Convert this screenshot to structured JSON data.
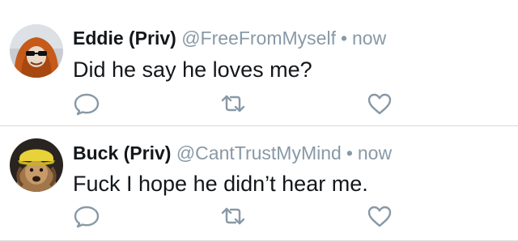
{
  "tweets": [
    {
      "display_name": "Eddie (Priv)",
      "handle": "@FreeFromMyself",
      "separator": "•",
      "timestamp": "now",
      "text": "Did he say he loves me?",
      "avatar_icon": "orange-hoodie-sunglasses-avatar"
    },
    {
      "display_name": "Buck (Priv)",
      "handle": "@CantTrustMyMind",
      "separator": "•",
      "timestamp": "now",
      "text": "Fuck I hope he didn’t hear me.",
      "avatar_icon": "dog-with-yellow-cap-avatar"
    }
  ],
  "colors": {
    "name": "#14171a",
    "meta": "#8899a6",
    "icon": "#8899a6",
    "divider": "#d6d8da"
  },
  "actions": {
    "reply_icon": "reply-icon",
    "retweet_icon": "retweet-icon",
    "like_icon": "heart-icon"
  }
}
